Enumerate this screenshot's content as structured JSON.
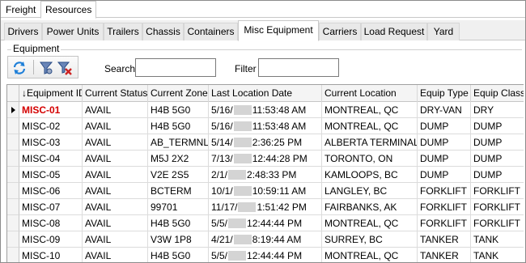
{
  "top_tabs": [
    "Freight",
    "Resources"
  ],
  "sub_tabs": [
    "Drivers",
    "Power Units",
    "Trailers",
    "Chassis",
    "Containers",
    "Misc Equipment",
    "Carriers",
    "Load Request",
    "Yard"
  ],
  "active_sub_tab": "Misc Equipment",
  "group_label": "Equipment",
  "search_label": "Search",
  "search_value": "",
  "filter_label": "Filter",
  "filter_value": "",
  "columns": [
    "↓Equipment ID",
    "Current Status",
    "Current Zone",
    "Last Location Date",
    "Current Location",
    "Equip Type",
    "Equip Class"
  ],
  "rows": [
    {
      "id": "MISC-01",
      "status": "AVAIL",
      "zone": "H4B 5G0",
      "date_a": "5/16/",
      "time": "11:53:48 AM",
      "location": "MONTREAL, QC",
      "type": "DRY-VAN",
      "class": "DRY"
    },
    {
      "id": "MISC-02",
      "status": "AVAIL",
      "zone": "H4B 5G0",
      "date_a": "5/16/",
      "time": "11:53:48 AM",
      "location": "MONTREAL, QC",
      "type": "DUMP",
      "class": "DUMP"
    },
    {
      "id": "MISC-03",
      "status": "AVAIL",
      "zone": "AB_TERMNL",
      "date_a": "5/14/",
      "time": "2:36:25 PM",
      "location": "ALBERTA TERMINAL",
      "type": "DUMP",
      "class": "DUMP"
    },
    {
      "id": "MISC-04",
      "status": "AVAIL",
      "zone": "M5J 2X2",
      "date_a": "7/13/",
      "time": "12:44:28 PM",
      "location": "TORONTO, ON",
      "type": "DUMP",
      "class": "DUMP"
    },
    {
      "id": "MISC-05",
      "status": "AVAIL",
      "zone": "V2E 2S5",
      "date_a": "2/1/",
      "time": "2:48:33 PM",
      "location": "KAMLOOPS, BC",
      "type": "DUMP",
      "class": "DUMP"
    },
    {
      "id": "MISC-06",
      "status": "AVAIL",
      "zone": "BCTERM",
      "date_a": "10/1/",
      "time": "10:59:11 AM",
      "location": "LANGLEY, BC",
      "type": "FORKLIFT",
      "class": "FORKLIFT"
    },
    {
      "id": "MISC-07",
      "status": "AVAIL",
      "zone": "99701",
      "date_a": "11/17/",
      "time": "1:51:42 PM",
      "location": "FAIRBANKS, AK",
      "type": "FORKLIFT",
      "class": "FORKLIFT"
    },
    {
      "id": "MISC-08",
      "status": "AVAIL",
      "zone": "H4B 5G0",
      "date_a": "5/5/",
      "time": "12:44:44 PM",
      "location": "MONTREAL, QC",
      "type": "FORKLIFT",
      "class": "FORKLIFT"
    },
    {
      "id": "MISC-09",
      "status": "AVAIL",
      "zone": "V3W 1P8",
      "date_a": "4/21/",
      "time": "8:19:44 AM",
      "location": "SURREY, BC",
      "type": "TANKER",
      "class": "TANK"
    },
    {
      "id": "MISC-10",
      "status": "AVAIL",
      "zone": "H4B 5G0",
      "date_a": "5/5/",
      "time": "12:44:44 PM",
      "location": "MONTREAL, QC",
      "type": "TANKER",
      "class": "TANK"
    }
  ],
  "colors": {
    "selected_id": "#d40000",
    "refresh_icon": "#1e7fd8",
    "delete_icon": "#cc2222"
  },
  "icons": [
    "refresh-icon",
    "filter-rows-icon",
    "clear-filter-icon",
    "current-row-arrow-icon"
  ]
}
